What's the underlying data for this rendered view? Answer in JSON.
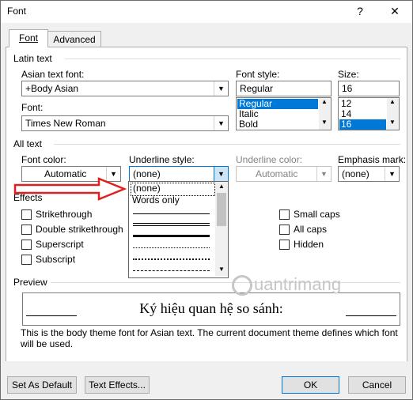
{
  "window": {
    "title": "Font",
    "help": "?",
    "close": "✕"
  },
  "tabs": [
    {
      "label": "Font"
    },
    {
      "label": "Advanced"
    }
  ],
  "latin": {
    "group": "Latin text",
    "asian_label": "Asian text font:",
    "asian_value": "+Body Asian",
    "font_label": "Font:",
    "font_value": "Times New Roman",
    "style_label": "Font style:",
    "style_value": "Regular",
    "style_options": [
      "Regular",
      "Italic",
      "Bold"
    ],
    "size_label": "Size:",
    "size_value": "16",
    "size_options": [
      "12",
      "14",
      "16"
    ]
  },
  "alltext": {
    "group": "All text",
    "color_label": "Font color:",
    "color_value": "Automatic",
    "underline_label": "Underline style:",
    "underline_value": "(none)",
    "ucolor_label": "Underline color:",
    "ucolor_value": "Automatic",
    "emphasis_label": "Emphasis mark:",
    "emphasis_value": "(none)"
  },
  "underline_dropdown": {
    "items": [
      "(none)",
      "Words only"
    ]
  },
  "effects": {
    "group": "Effects",
    "left": [
      "Strikethrough",
      "Double strikethrough",
      "Superscript",
      "Subscript"
    ],
    "right": [
      "Small caps",
      "All caps",
      "Hidden"
    ]
  },
  "preview": {
    "group": "Preview",
    "text": "Ký hiệu quan hệ so sánh:",
    "description": "This is the body theme font for Asian text. The current document theme defines which font will be used."
  },
  "buttons": {
    "default": "Set As Default",
    "effects": "Text Effects...",
    "ok": "OK",
    "cancel": "Cancel"
  },
  "watermark": "uantrimang",
  "colors": {
    "accent": "#0078d7",
    "arrow": "#e02020"
  }
}
